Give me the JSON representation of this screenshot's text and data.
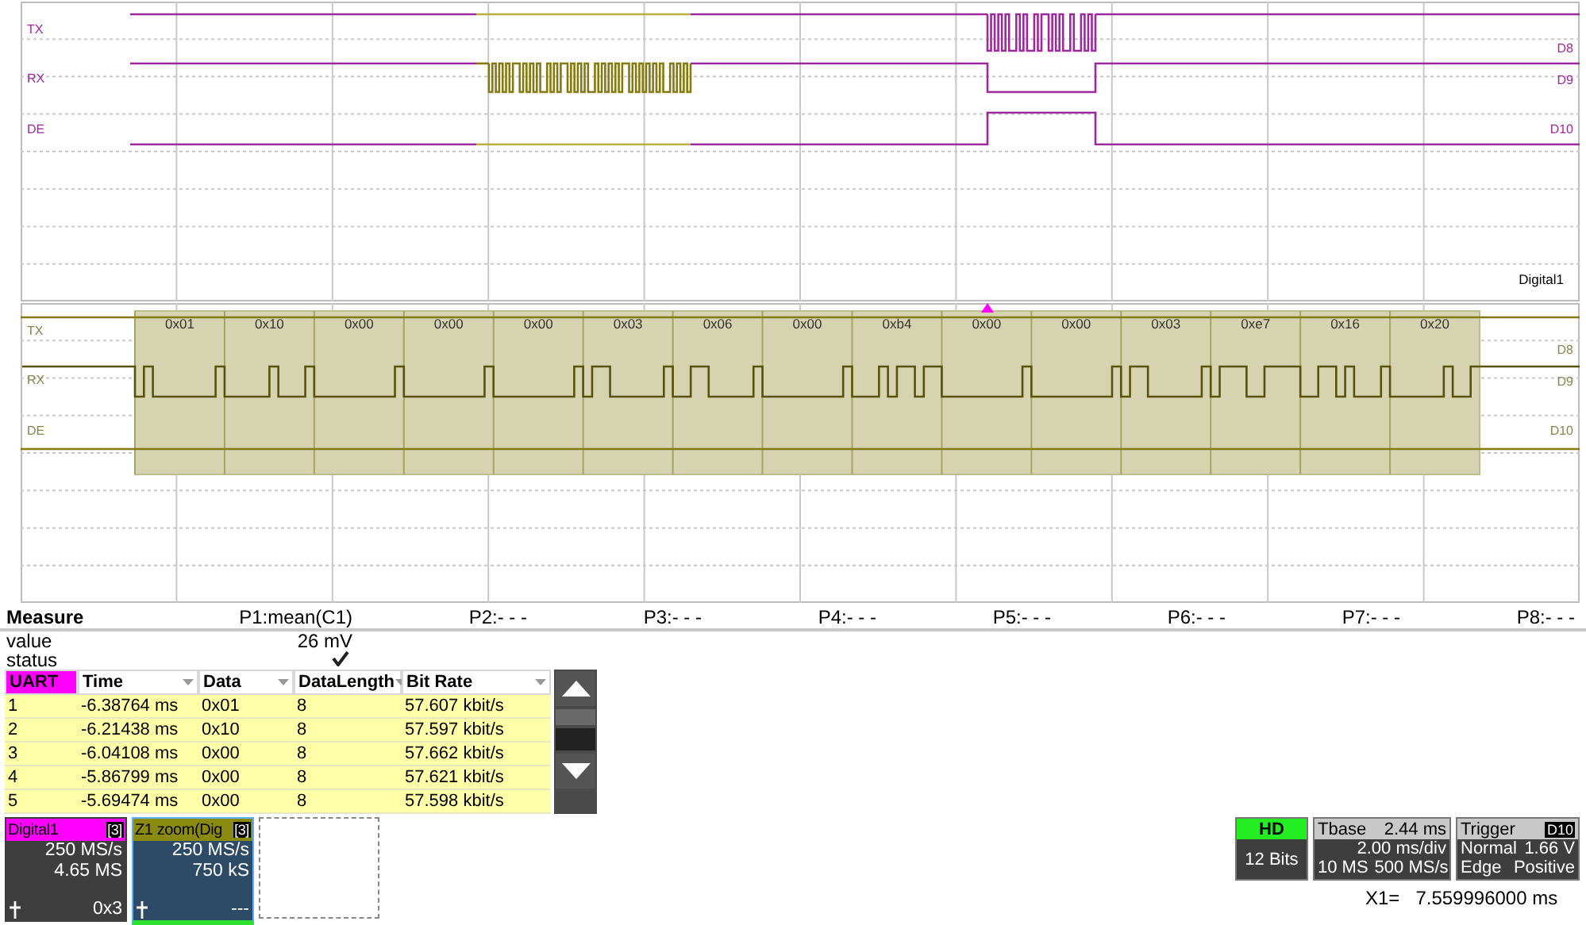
{
  "overview": {
    "channels": [
      {
        "label": "TX",
        "pin": "D8"
      },
      {
        "label": "RX",
        "pin": "D9"
      },
      {
        "label": "DE",
        "pin": "D10"
      }
    ],
    "source": "Digital1"
  },
  "zoom": {
    "channels": [
      {
        "label": "TX",
        "pin": "D8"
      },
      {
        "label": "RX",
        "pin": "D9"
      },
      {
        "label": "DE",
        "pin": "D10"
      }
    ],
    "bytes": [
      "0x01",
      "0x10",
      "0x00",
      "0x00",
      "0x00",
      "0x03",
      "0x06",
      "0x00",
      "0xb4",
      "0x00",
      "0x00",
      "0x03",
      "0xe7",
      "0x16",
      "0x20"
    ]
  },
  "measure": {
    "title": "Measure",
    "params": [
      "P1:mean(C1)",
      "P2:- - -",
      "P3:- - -",
      "P4:- - -",
      "P5:- - -",
      "P6:- - -",
      "P7:- - -",
      "P8:- - -"
    ],
    "value_label": "value",
    "value": "26 mV",
    "status_label": "status",
    "status_ok": true
  },
  "decode_table": {
    "columns": [
      "UART",
      "Time",
      "Data",
      "DataLength",
      "Bit Rate"
    ],
    "rows": [
      [
        "1",
        "-6.38764 ms",
        "0x01",
        "8",
        "57.607 kbit/s"
      ],
      [
        "2",
        "-6.21438 ms",
        "0x10",
        "8",
        "57.597 kbit/s"
      ],
      [
        "3",
        "-6.04108 ms",
        "0x00",
        "8",
        "57.662 kbit/s"
      ],
      [
        "4",
        "-5.86799 ms",
        "0x00",
        "8",
        "57.621 kbit/s"
      ],
      [
        "5",
        "-5.69474 ms",
        "0x00",
        "8",
        "57.598 kbit/s"
      ]
    ]
  },
  "channel_tiles": [
    {
      "kind": "source",
      "title": "Digital1",
      "badge": "[3]",
      "lines": [
        "250 MS/s",
        "4.65 MS"
      ],
      "footer": "0x3",
      "selected": false
    },
    {
      "kind": "zoom",
      "title": "Z1 zoom(Dig",
      "badge": "[3]",
      "lines": [
        "250 MS/s",
        "750 kS"
      ],
      "footer": "---",
      "selected": true
    }
  ],
  "acquisition": {
    "mode": "HD",
    "bits": "12 Bits"
  },
  "timebase": {
    "title": "Tbase",
    "delay": "2.44 ms",
    "scale": "2.00 ms/div",
    "points": "10 MS",
    "rate": "500 MS/s"
  },
  "trigger": {
    "title": "Trigger",
    "source": "D10",
    "mode": "Normal",
    "threshold": "1.66 V",
    "type": "Edge",
    "slope": "Positive"
  },
  "cursor": {
    "label": "X1=",
    "value": "7.559996000 ms"
  }
}
